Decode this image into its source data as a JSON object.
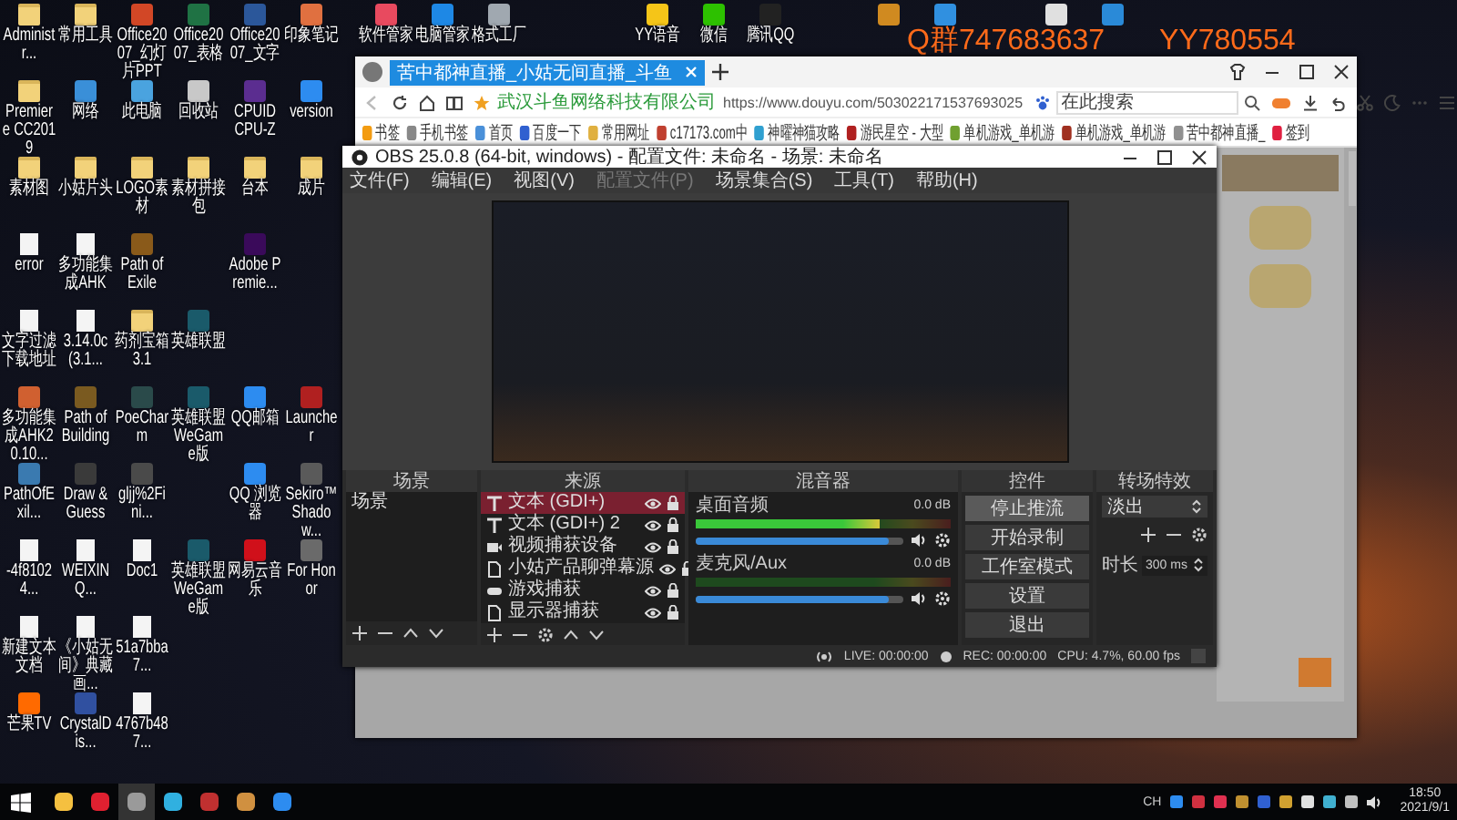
{
  "desktop": {
    "grid": [
      [
        {
          "label": "Administr...",
          "kind": "folder"
        },
        {
          "label": "常用工具",
          "kind": "folder"
        },
        {
          "label": "Office2007_幻灯片PPT",
          "kind": "app",
          "color": "#d24726"
        },
        {
          "label": "Office2007_表格",
          "kind": "app",
          "color": "#1f7244"
        },
        {
          "label": "Office2007_文字",
          "kind": "app",
          "color": "#2b579a"
        },
        {
          "label": "印象笔记",
          "kind": "app",
          "color": "#e07040"
        }
      ],
      [
        {
          "label": "Premiere CC2019",
          "kind": "folder"
        },
        {
          "label": "网络",
          "kind": "app",
          "color": "#3a8fd8"
        },
        {
          "label": "此电脑",
          "kind": "app",
          "color": "#4aa3df"
        },
        {
          "label": "回收站",
          "kind": "app",
          "color": "#c8c8c8"
        },
        {
          "label": "CPUID CPU-Z",
          "kind": "app",
          "color": "#5b2d90"
        },
        {
          "label": "version",
          "kind": "app",
          "color": "#2d8cf0"
        }
      ],
      [
        {
          "label": "素材图",
          "kind": "folder"
        },
        {
          "label": "小姑片头",
          "kind": "folder"
        },
        {
          "label": "LOGO素材",
          "kind": "folder"
        },
        {
          "label": "素材拼接包",
          "kind": "folder"
        },
        {
          "label": "台本",
          "kind": "folder"
        },
        {
          "label": "成片",
          "kind": "folder"
        }
      ],
      [
        {
          "label": "error",
          "kind": "document"
        },
        {
          "label": "多功能集成AHK",
          "kind": "document"
        },
        {
          "label": "Path of Exile",
          "kind": "app",
          "color": "#8a5a1a"
        },
        {
          "kind": "empty"
        },
        {
          "label": "Adobe Premie...",
          "kind": "app",
          "color": "#3a0a5a"
        },
        {
          "kind": "empty"
        }
      ],
      [
        {
          "label": "文字过滤下载地址",
          "kind": "document"
        },
        {
          "label": "3.14.0c(3.1...",
          "kind": "document"
        },
        {
          "label": "药剂宝箱3.1",
          "kind": "folder"
        },
        {
          "label": "英雄联盟",
          "kind": "app",
          "color": "#1a5a6a"
        },
        {
          "kind": "empty"
        },
        {
          "kind": "empty"
        }
      ],
      [
        {
          "label": "多功能集成AHK20.10...",
          "kind": "app",
          "color": "#d06030"
        },
        {
          "label": "Path of Building",
          "kind": "app",
          "color": "#7a5a20"
        },
        {
          "label": "PoeCharm",
          "kind": "app",
          "color": "#2a4a4a"
        },
        {
          "label": "英雄联盟WeGame版",
          "kind": "app",
          "color": "#1a5a6a"
        },
        {
          "label": "QQ邮箱",
          "kind": "app",
          "color": "#2d8cf0"
        },
        {
          "label": "Launcher",
          "kind": "app",
          "color": "#b02020"
        }
      ],
      [
        {
          "label": "PathOfExil...",
          "kind": "app",
          "color": "#3a7ab0"
        },
        {
          "label": "Draw & Guess",
          "kind": "app",
          "color": "#3a3a3a"
        },
        {
          "label": "gljj%2Fini...",
          "kind": "app",
          "color": "#4a4a4a"
        },
        {
          "kind": "empty"
        },
        {
          "label": "QQ 浏览器",
          "kind": "app",
          "color": "#2d8cf0"
        },
        {
          "label": "Sekiro™ Shadow...",
          "kind": "app",
          "color": "#5a5a5a"
        }
      ],
      [
        {
          "label": "-4f81024...",
          "kind": "document"
        },
        {
          "label": "WEIXINQ...",
          "kind": "document"
        },
        {
          "label": "Doc1",
          "kind": "document"
        },
        {
          "label": "英雄联盟WeGame版",
          "kind": "app",
          "color": "#1a5a6a"
        },
        {
          "label": "网易云音乐",
          "kind": "app",
          "color": "#d0101a"
        },
        {
          "label": "For Honor",
          "kind": "app",
          "color": "#6a6a6a"
        }
      ],
      [
        {
          "label": "新建文本文档",
          "kind": "document"
        },
        {
          "label": "《小姑无间》典藏画...",
          "kind": "document"
        },
        {
          "label": "51a7bba7...",
          "kind": "document"
        },
        {
          "kind": "empty"
        },
        {
          "kind": "empty"
        },
        {
          "kind": "empty"
        }
      ],
      [
        {
          "label": "芒果TV",
          "kind": "app",
          "color": "#ff6a00"
        },
        {
          "label": "CrystalDis...",
          "kind": "app",
          "color": "#3050a0"
        },
        {
          "label": "4767b487...",
          "kind": "document"
        },
        {
          "kind": "empty"
        },
        {
          "kind": "empty"
        },
        {
          "kind": "empty"
        }
      ]
    ],
    "top_groups": [
      [
        {
          "label": "软件管家",
          "kind": "app",
          "color": "#e84a5f"
        },
        {
          "label": "电脑管家",
          "kind": "app",
          "color": "#1e88e5"
        },
        {
          "label": "格式工厂",
          "kind": "app",
          "color": "#a0a8b0"
        }
      ],
      [
        {
          "label": "YY语音",
          "kind": "app",
          "color": "#f5c518"
        },
        {
          "label": "微信",
          "kind": "app",
          "color": "#2dc100"
        },
        {
          "label": "腾讯QQ",
          "kind": "app",
          "color": "#222222"
        }
      ],
      [
        {
          "kind": "app",
          "color": "#d08a20"
        },
        {
          "kind": "app",
          "color": "#3090e0"
        }
      ],
      [
        {
          "kind": "app",
          "color": "#e0e0e0"
        },
        {
          "kind": "app",
          "color": "#2a8ad8"
        }
      ]
    ],
    "overlay": [
      "Q群747683637",
      "YY780554"
    ]
  },
  "browser": {
    "tabs": [
      {
        "title": "苦中都神直播_小姑无间直播_斗鱼",
        "selected": true
      }
    ],
    "site_name": "武汉斗鱼网络科技有限公司",
    "url": "https://www.douyu.com/503022171537693025",
    "search": {
      "placeholder": "在此搜索"
    },
    "bookmarks": [
      {
        "label": "书签",
        "color": "#f39c12"
      },
      {
        "label": "手机书签",
        "color": "#888888"
      },
      {
        "label": "首页",
        "color": "#4a90d9"
      },
      {
        "label": "百度一下",
        "color": "#3060d0"
      },
      {
        "label": "常用网址",
        "color": "#e0b040"
      },
      {
        "label": "c17173.com中",
        "color": "#c04030"
      },
      {
        "label": "神曜神猫攻略",
        "color": "#30a0d0"
      },
      {
        "label": "游民星空 - 大型",
        "color": "#b02020"
      },
      {
        "label": "单机游戏_单机游",
        "color": "#70a030"
      },
      {
        "label": "单机游戏_单机游",
        "color": "#a03020"
      },
      {
        "label": "苦中都神直播_",
        "color": "#909090"
      },
      {
        "label": "签到",
        "color": "#e02040"
      }
    ]
  },
  "obs": {
    "title": "OBS 25.0.8 (64-bit, windows) - 配置文件: 未命名 - 场景: 未命名",
    "menu": [
      {
        "label": "文件(F)",
        "disabled": false
      },
      {
        "label": "编辑(E)",
        "disabled": false
      },
      {
        "label": "视图(V)",
        "disabled": false
      },
      {
        "label": "配置文件(P)",
        "disabled": true
      },
      {
        "label": "场景集合(S)",
        "disabled": false
      },
      {
        "label": "工具(T)",
        "disabled": false
      },
      {
        "label": "帮助(H)",
        "disabled": false
      }
    ],
    "scenes": {
      "title": "场景",
      "items": [
        {
          "label": "场景",
          "selected": false
        }
      ]
    },
    "sources": {
      "title": "来源",
      "items": [
        {
          "label": "文本 (GDI+)",
          "kind": "text",
          "selected": true
        },
        {
          "label": "文本 (GDI+) 2",
          "kind": "text",
          "selected": false
        },
        {
          "label": "视频捕获设备",
          "kind": "camera",
          "selected": false
        },
        {
          "label": "小姑产品聊弹幕源",
          "kind": "file",
          "selected": false
        },
        {
          "label": "游戏捕获",
          "kind": "game",
          "selected": false
        },
        {
          "label": "显示器捕获",
          "kind": "file",
          "selected": false
        }
      ]
    },
    "mixer": {
      "title": "混音器",
      "channels": [
        {
          "name": "桌面音频",
          "reading": "0.0 dB",
          "meter": {
            "level": 0.72
          },
          "volume": {
            "level": 0.93
          }
        },
        {
          "name": "麦克风/Aux",
          "reading": "0.0 dB",
          "meter": {
            "level": 0.0
          },
          "volume": {
            "level": 0.93
          }
        }
      ]
    },
    "controls": {
      "title": "控件",
      "buttons": [
        {
          "label": "停止推流",
          "active": true
        },
        {
          "label": "开始录制",
          "active": false
        },
        {
          "label": "工作室模式",
          "active": false
        },
        {
          "label": "设置",
          "active": false
        },
        {
          "label": "退出",
          "active": false
        }
      ]
    },
    "transitions": {
      "title": "转场特效",
      "value": "淡出",
      "duration_label": "时长",
      "duration": "300 ms"
    },
    "status": {
      "live": "LIVE: 00:00:00",
      "rec": "REC: 00:00:00",
      "cpu": "CPU: 4.7%, 60.00 fps"
    }
  },
  "taskbar": {
    "apps": [
      {
        "color": "#f5c040",
        "active": false
      },
      {
        "color": "#e02030",
        "active": false
      },
      {
        "color": "#9a9a9a",
        "active": true
      },
      {
        "color": "#30b0e0",
        "active": false
      },
      {
        "color": "#c03030",
        "active": false
      },
      {
        "color": "#d09040",
        "active": false
      },
      {
        "color": "#2d8cf0",
        "active": false
      }
    ],
    "ime": "CH",
    "time": "18:50",
    "date": "2021/9/1"
  }
}
